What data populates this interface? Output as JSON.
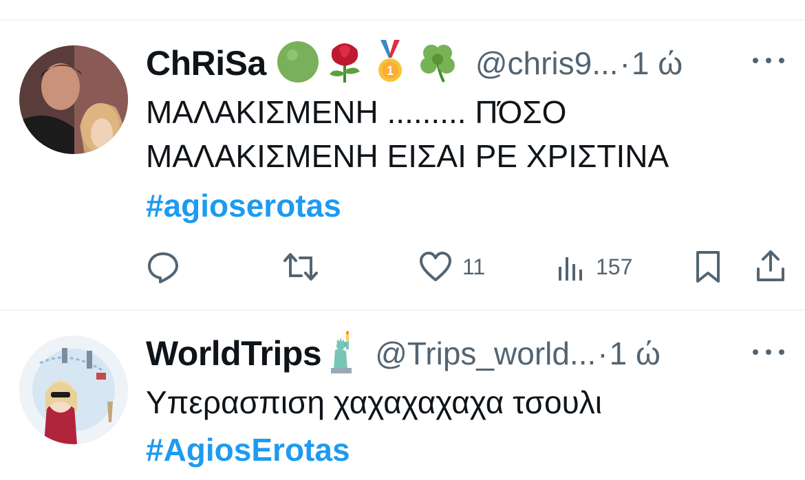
{
  "tweets": [
    {
      "name": "ChRiSa",
      "handle": "@chris9...",
      "dot": "·",
      "time": "1 ώ",
      "line1": "ΜΑΛΑΚΙΣΜΕΝΗ ......... ΠΌΣΟ",
      "line2": "ΜΑΛΑΚΙΣΜΕΝΗ ΕΙΣΑΙ ΡΕ ΧΡΙΣΤΙΝΑ",
      "hashtag": "#agioserotas",
      "badges": [
        "green-circle-icon",
        "rose-icon",
        "medal-icon",
        "shamrock-icon"
      ],
      "actions": {
        "likes": "11",
        "views": "157"
      }
    },
    {
      "name": "WorldTrips",
      "handle": "@Trips_world...",
      "dot": "·",
      "time": "1 ώ",
      "line1": "Υπερασπιση χαχαχαχαχα τσουλι",
      "hashtag": "#AgiosErotas",
      "badges": [
        "statue-of-liberty-icon"
      ]
    }
  ],
  "colors": {
    "link": "#1d9bf0",
    "secondary": "#536471",
    "text": "#0f1419",
    "divider": "#eff3f4"
  }
}
